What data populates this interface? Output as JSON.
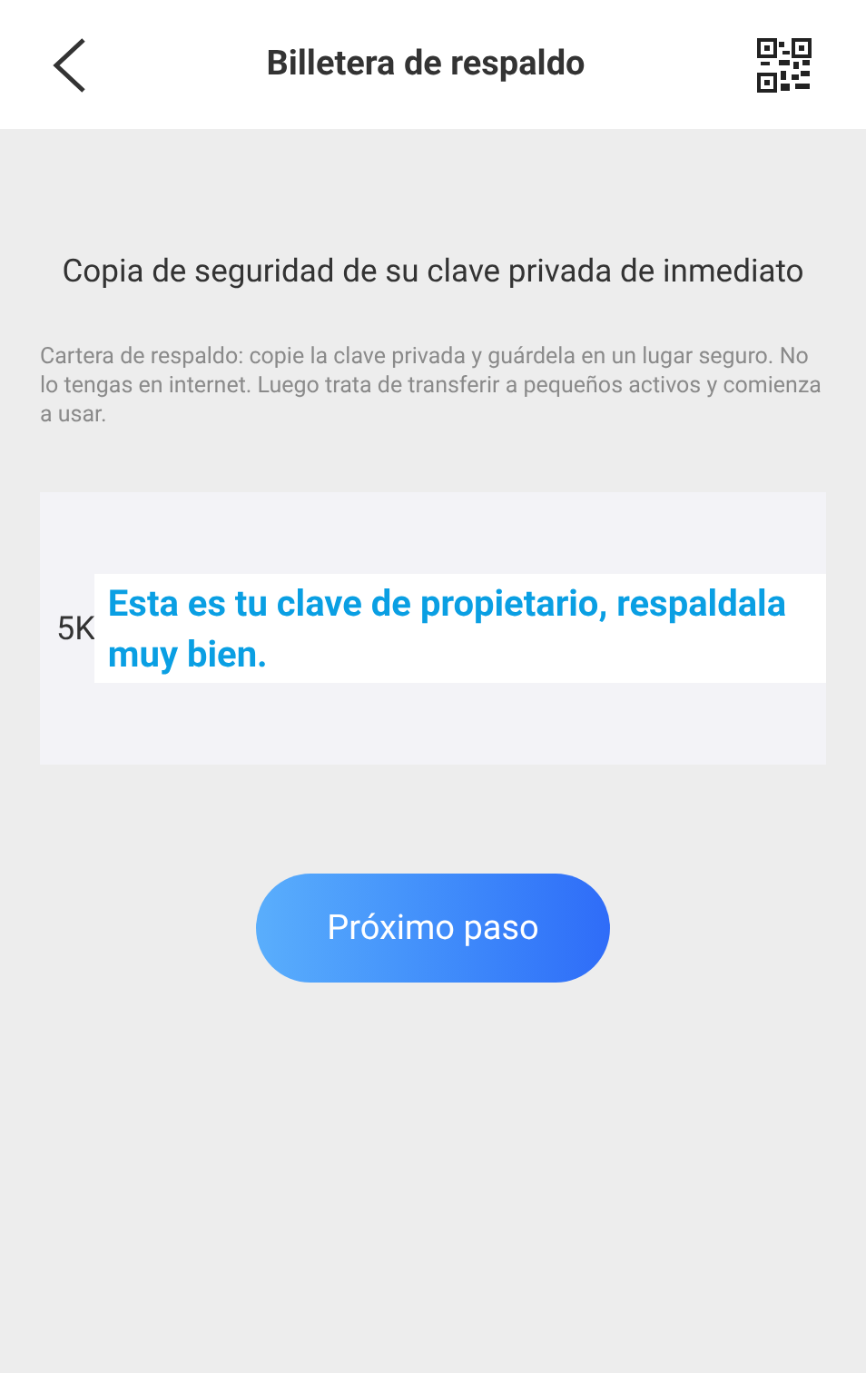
{
  "header": {
    "title": "Billetera de respaldo"
  },
  "heading": "Copia de seguridad de su clave privada de inmediato",
  "description": "Cartera de respaldo: copie la clave privada y guárdela en un lugar seguro. No lo tengas en internet. Luego trata de transferir a pequeños activos y comienza a usar.",
  "key_card": {
    "key": "5K",
    "overlay_note": "Esta es tu clave de propietario, respaldala muy bien."
  },
  "next_button": "Próximo paso"
}
